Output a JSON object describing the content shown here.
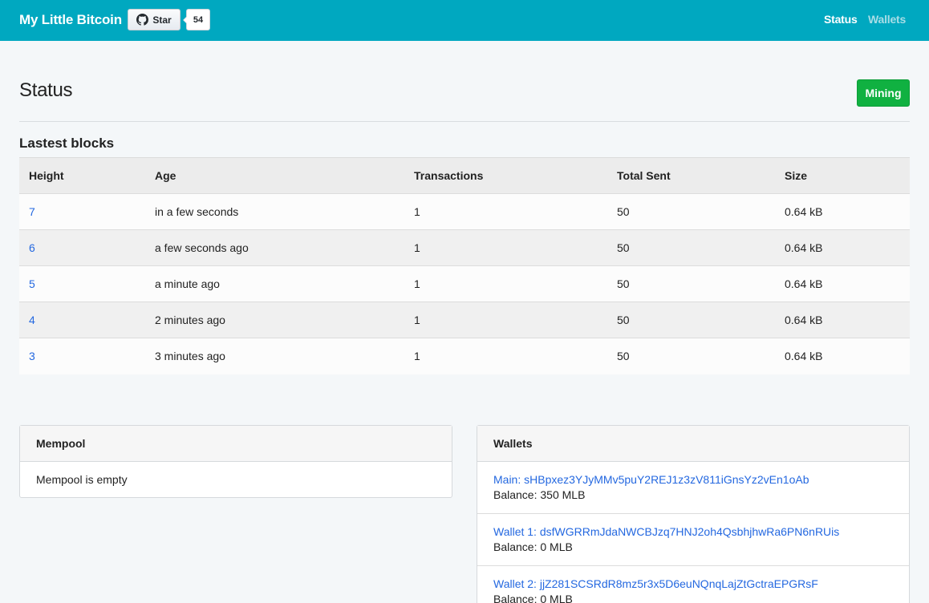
{
  "navbar": {
    "brand": "My Little Bitcoin",
    "github_star_label": "Star",
    "github_star_count": "54",
    "links": [
      {
        "label": "Status",
        "active": true
      },
      {
        "label": "Wallets",
        "active": false
      }
    ]
  },
  "page": {
    "title": "Status",
    "mining_button": "Mining"
  },
  "blocks": {
    "title": "Lastest blocks",
    "headers": [
      "Height",
      "Age",
      "Transactions",
      "Total Sent",
      "Size"
    ],
    "rows": [
      {
        "height": "7",
        "age": "in a few seconds",
        "transactions": "1",
        "total_sent": "50",
        "size": "0.64 kB"
      },
      {
        "height": "6",
        "age": "a few seconds ago",
        "transactions": "1",
        "total_sent": "50",
        "size": "0.64 kB"
      },
      {
        "height": "5",
        "age": "a minute ago",
        "transactions": "1",
        "total_sent": "50",
        "size": "0.64 kB"
      },
      {
        "height": "4",
        "age": "2 minutes ago",
        "transactions": "1",
        "total_sent": "50",
        "size": "0.64 kB"
      },
      {
        "height": "3",
        "age": "3 minutes ago",
        "transactions": "1",
        "total_sent": "50",
        "size": "0.64 kB"
      }
    ]
  },
  "mempool": {
    "title": "Mempool",
    "body": "Mempool is empty"
  },
  "wallets": {
    "title": "Wallets",
    "items": [
      {
        "label": "Main: sHBpxez3YJyMMv5puY2REJ1z3zV811iGnsYz2vEn1oAb",
        "balance": "Balance: 350 MLB"
      },
      {
        "label": "Wallet 1: dsfWGRRmJdaNWCBJzq7HNJ2oh4QsbhjhwRa6PN6nRUis",
        "balance": "Balance: 0 MLB"
      },
      {
        "label": "Wallet 2: jjZ281SCSRdR8mz5r3x5D6euNQnqLajZtGctraEPGRsF",
        "balance": "Balance: 0 MLB"
      }
    ]
  },
  "colors": {
    "navbar": "#00a8c0",
    "mining": "#10b141",
    "link": "#2468e0"
  }
}
